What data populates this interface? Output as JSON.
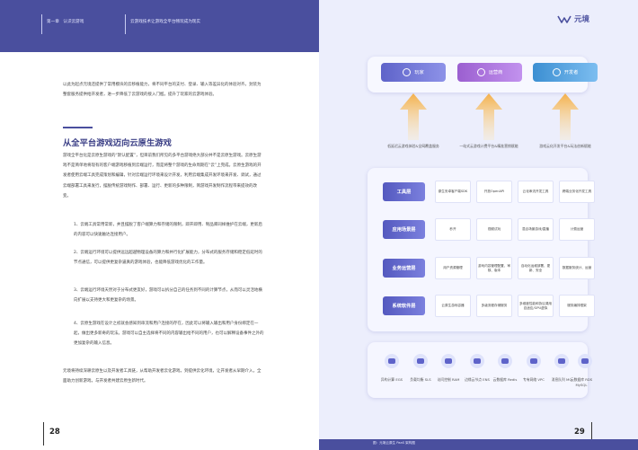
{
  "left": {
    "header": {
      "chapter": "第一章　认识云游戏",
      "title": "云游戏技术让游戏全平台畅玩成为现实"
    },
    "intro": "以此为起点元境还提供了常用模块的云移植能力，将不同平台的支付、登录、输入等差异化的体验对齐，封装为整套服务提供给开发者，进一步降低了云游戏的接入门槛，提升了玩家的云游戏体验。",
    "section_title": "从全平台游戏迈向云原生游戏",
    "body": "游戏全平台化是云原生游戏的“默认配置”，但目前我们所见的多平台游戏绝大部分并不是云原生游戏。云原生游戏不是简单地将现有的客户端游戏移植到云端运行，而是将整个游戏的生命周期在“云”上完成。云原生游戏的开发者使用云端工具完成策划和编辑，针对云端运行环境来设计开发，利用云端集成开发环境来开发、调试，通过云端部署工具来发行，摆脱传统游戏制作、部署、运行、更新的多种限制，简游戏开发制作流程带来提效的改变。",
    "points": [
      "1、云端工具常用常新，并且摆脱了客户端算力和存储的限制，即开即用、制品库同样维护在云端，更新后的内容可以快速触达连接用户。",
      "2、云端运行环境可以提供远远超越物理设备的算力和并行化扩展能力，分布式的服务存储和稳定低延时的节点通信，可以提供更复杂逼真的游戏体验，也能降低游戏优化的工作量。",
      "3、云端运行环境天然对于分布式更友好，游戏可以拆分自己的任务到不同的计算节点，从而可以灵活地横向扩展以支持更大和更复杂的场景。",
      "4、云原生游戏在设计之初就会感知到串流和用户连接的存在，因此可以将输入输出和用户身份绑定在一起，做出更多新奇的玩法。游戏可以自主选择将不同的内容输出给不同的用户，也可以解释设备事件之外的更加复杂的输入信息。"
    ],
    "closing": "元境将持续深耕云原生以及开发者工具链，从帮助开发者云化游戏，到提供云化环境，让开发者从早期介入，全面助力创新游戏，与开发者共建云原生新时代。",
    "page_number": "28"
  },
  "right": {
    "logo_text": "元境",
    "roles": [
      {
        "label": "玩家",
        "icon": "gamepad-icon"
      },
      {
        "label": "运营商",
        "icon": "server-icon"
      },
      {
        "label": "开发者",
        "icon": "code-icon"
      }
    ],
    "arrow_captions": [
      "低延迟云游戏体验&全网覆盖服务",
      "一站式云游戏计费平台&精准营销赋能",
      "游戏云化开发平台&玩法创新赋能"
    ],
    "layers": [
      {
        "label": "工具层",
        "cells": [
          "原生安卓客户端SDK",
          "开放OpenAPI",
          "云化串流开发工具",
          "跨端业务化开发工具"
        ]
      },
      {
        "label": "应用场景层",
        "cells": [
          "秒开",
          "视频试玩",
          "混合场景游戏/直播",
          "计费运营"
        ]
      },
      {
        "label": "业务运营层",
        "cells": [
          "用户资源管理",
          "游戏内容管理配置、审核、版本",
          "自动化运维部署、更新、安全",
          "数据服务统计、运营"
        ]
      },
      {
        "label": "系统软件层",
        "cells": [
          "云原生游戏容器",
          "多级流程存储服务",
          "多维度性能和协议调用自适应/GPU虚拟",
          "服务编排框架"
        ]
      }
    ],
    "services": [
      {
        "icon": "compute-icon",
        "label": "异构计算 EGS"
      },
      {
        "icon": "balancer-icon",
        "label": "负载均衡 SLS"
      },
      {
        "icon": "cloud-icon",
        "label": "访问控制 RAM"
      },
      {
        "icon": "network-icon",
        "label": "边缘云节点 ENS"
      },
      {
        "icon": "database-icon",
        "label": "云数据库 Redis"
      },
      {
        "icon": "vpc-icon",
        "label": "专有网络 VPC"
      },
      {
        "icon": "queue-icon",
        "label": "消息队列 MQ"
      },
      {
        "icon": "db-icon",
        "label": "云数据库 RDS MySQL"
      }
    ],
    "footer": "图：元境云原生 PaaS 架构图",
    "page_number": "29"
  },
  "colors": {
    "brand": "#4a4f9e",
    "right_bg": "#eceefc",
    "arrow_yellow": "#f7c86a"
  }
}
